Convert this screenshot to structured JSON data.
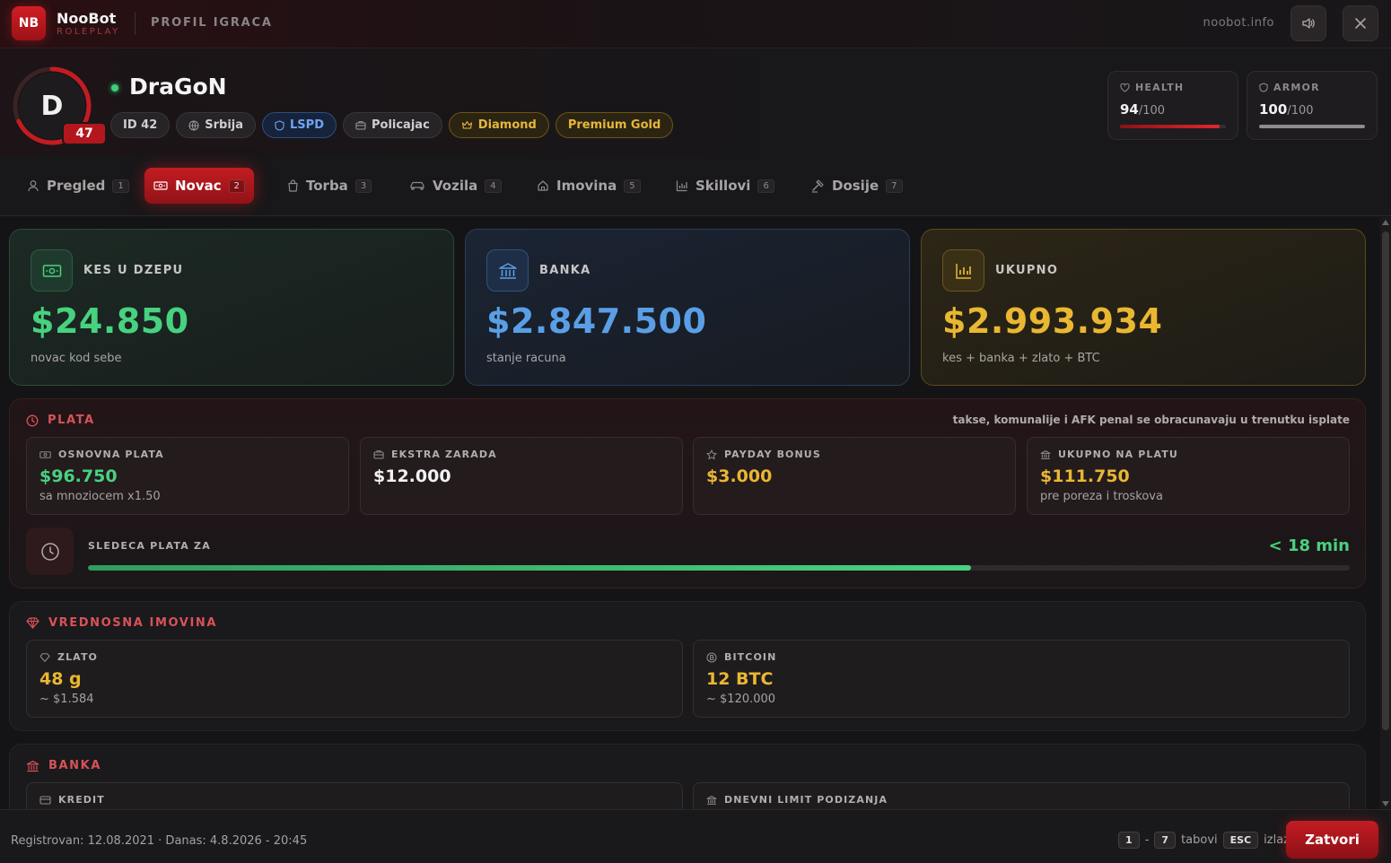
{
  "colors": {
    "accent_red": "#c21c22",
    "green": "#48d17f",
    "blue": "#5a9fe6",
    "gold": "#e9b731"
  },
  "topbar": {
    "logo": "NB",
    "brand_name": "NooBot",
    "brand_sub": "ROLEPLAY",
    "page_title": "PROFIL IGRACA",
    "site": "noobot.info",
    "sound_icon": "speaker-icon",
    "close_icon": "close-icon"
  },
  "profile": {
    "avatar_letter": "D",
    "level": "47",
    "level_progress": 0.68,
    "name": "DraGoN",
    "online": true,
    "tags": {
      "id": "ID 42",
      "country": "Srbija",
      "faction": "LSPD",
      "job": "Policajac",
      "rank": "Diamond",
      "premium": "Premium Gold"
    },
    "health": {
      "label": "HEALTH",
      "value": "94",
      "max": "/100",
      "fraction": 0.94
    },
    "armor": {
      "label": "ARMOR",
      "value": "100",
      "max": "/100",
      "fraction": 1.0
    }
  },
  "tabs": [
    {
      "label": "Pregled",
      "num": "1",
      "icon": "user-icon"
    },
    {
      "label": "Novac",
      "num": "2",
      "icon": "cash-icon",
      "active": true
    },
    {
      "label": "Torba",
      "num": "3",
      "icon": "bag-icon"
    },
    {
      "label": "Vozila",
      "num": "4",
      "icon": "car-icon"
    },
    {
      "label": "Imovina",
      "num": "5",
      "icon": "home-icon"
    },
    {
      "label": "Skillovi",
      "num": "6",
      "icon": "chart-icon"
    },
    {
      "label": "Dosije",
      "num": "7",
      "icon": "gavel-icon"
    }
  ],
  "money": {
    "cash": {
      "label": "KES U DZEPU",
      "value": "$24.850",
      "sub": "novac kod sebe"
    },
    "bank": {
      "label": "BANKA",
      "value": "$2.847.500",
      "sub": "stanje racuna"
    },
    "total": {
      "label": "UKUPNO",
      "value": "$2.993.934",
      "sub": "kes + banka + zlato + BTC"
    }
  },
  "salary": {
    "title": "PLATA",
    "note": "takse, komunalije i AFK penal se obracunavaju u trenutku isplate",
    "base": {
      "label": "OSNOVNA PLATA",
      "value": "$96.750",
      "sub": "sa mnoziocem x1.50"
    },
    "extra": {
      "label": "EKSTRA ZARADA",
      "value": "$12.000"
    },
    "bonus": {
      "label": "PAYDAY BONUS",
      "value": "$3.000"
    },
    "total": {
      "label": "UKUPNO NA PLATU",
      "value": "$111.750",
      "sub": "pre poreza i troskova"
    },
    "next": {
      "label": "SLEDECA PLATA ZA",
      "time": "< 18 min",
      "progress": 0.7
    }
  },
  "assets": {
    "title": "VREDNOSNA IMOVINA",
    "gold": {
      "label": "ZLATO",
      "value": "48 g",
      "sub": "~ $1.584"
    },
    "btc": {
      "label": "BITCOIN",
      "value": "12 BTC",
      "sub": "~ $120.000"
    }
  },
  "bank_section": {
    "title": "BANKA",
    "credit": {
      "label": "KREDIT"
    },
    "limit": {
      "label": "DNEVNI LIMIT PODIZANJA"
    }
  },
  "footer": {
    "registered": "Registrovan: 12.08.2021 · Danas: 4.8.2026 - 20:45",
    "key_from": "1",
    "key_dash": "-",
    "key_to": "7",
    "key_tabs_label": "tabovi",
    "key_esc": "ESC",
    "key_esc_label": "izlaz",
    "close_label": "Zatvori"
  }
}
